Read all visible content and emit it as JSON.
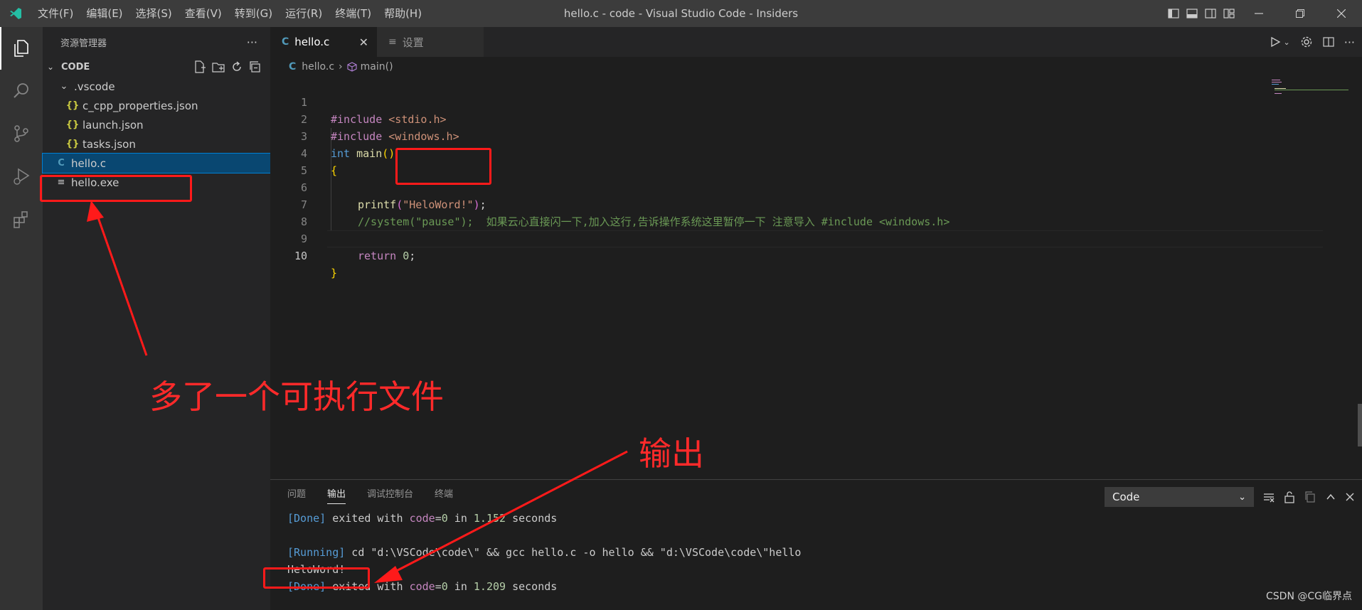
{
  "titlebar": {
    "menu": [
      "文件(F)",
      "编辑(E)",
      "选择(S)",
      "查看(V)",
      "转到(G)",
      "运行(R)",
      "终端(T)",
      "帮助(H)"
    ],
    "title": "hello.c - code - Visual Studio Code - Insiders"
  },
  "sidebar": {
    "title": "资源管理器",
    "more": "···",
    "section": "CODE",
    "tree": [
      {
        "label": ".vscode",
        "icon": "chevron-down-icon"
      },
      {
        "label": "c_cpp_properties.json",
        "icon": "{}"
      },
      {
        "label": "launch.json",
        "icon": "{}"
      },
      {
        "label": "tasks.json",
        "icon": "{}"
      },
      {
        "label": "hello.c",
        "icon": "C"
      },
      {
        "label": "hello.exe",
        "icon": "≡"
      }
    ]
  },
  "tabs": [
    {
      "label": "hello.c",
      "icon": "C",
      "close": "✕"
    },
    {
      "label": "设置",
      "icon": "≡"
    }
  ],
  "breadcrumb": {
    "file": "hello.c",
    "symbol": "main()"
  },
  "editor": {
    "line_numbers": [
      "1",
      "2",
      "3",
      "4",
      "5",
      "6",
      "7",
      "8",
      "9",
      "10"
    ],
    "lines": {
      "l1_pp": "#include",
      "l1_str": " <stdio.h>",
      "l2_pp": "#include",
      "l2_str": " <windows.h>",
      "l3_type": "int",
      "l3_fn": " main",
      "l3_paren": "()",
      "l4_brace": "{",
      "l6_fn": "printf",
      "l6_open": "(",
      "l6_str": "\"HeloWord!\"",
      "l6_close": ")",
      "l6_semi": ";",
      "l7_comment": "//system(\"pause\");  如果云心直接闪一下,加入这行,告诉操作系统这里暂停一下 注意导入 #include <windows.h>",
      "l9_kw": "return",
      "l9_num": " 0",
      "l9_semi": ";",
      "l10_brace": "}"
    }
  },
  "panel": {
    "tabs": [
      "问题",
      "输出",
      "调试控制台",
      "终端"
    ],
    "active_tab": "输出",
    "channel": "Code",
    "output": {
      "o1_done": "[Done]",
      "o1_a": " exited with ",
      "o1_code": "code",
      "o1_b": "=",
      "o1_num": "0",
      "o1_c": " in ",
      "o1_time": "1.152",
      "o1_d": " seconds",
      "o2_running": "[Running]",
      "o2_cmd": " cd \"d:\\VSCode\\code\\\" && gcc hello.c -o hello && \"d:\\VSCode\\code\\\"hello",
      "o3": "HeloWord!",
      "o4_done": "[Done]",
      "o4_a": " exited with ",
      "o4_code": "code",
      "o4_b": "=",
      "o4_num": "0",
      "o4_c": " in ",
      "o4_time": "1.209",
      "o4_d": " seconds"
    }
  },
  "annotations": {
    "exe_note": "多了一个可执行文件",
    "output_note": "输出"
  },
  "watermark": "CSDN @CG临界点",
  "colors": {
    "accent": "#007acc",
    "annotation": "#ff1a1a",
    "selection": "#094771"
  }
}
